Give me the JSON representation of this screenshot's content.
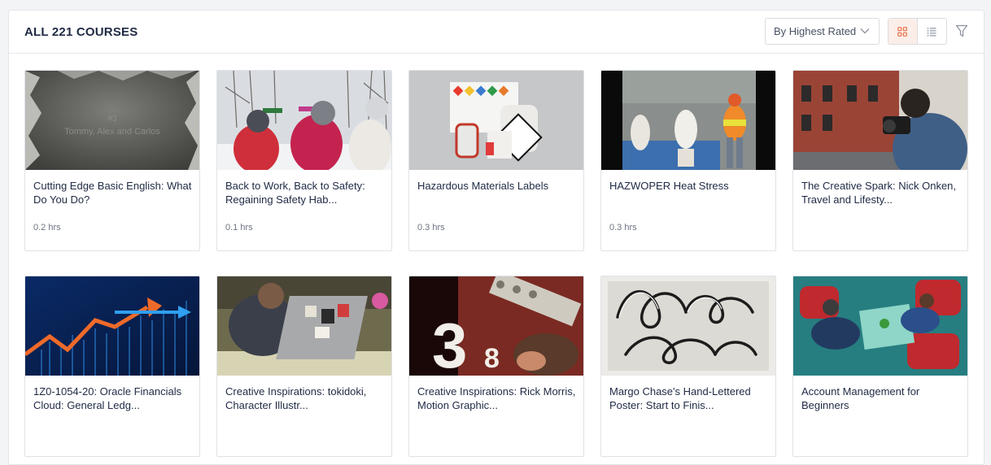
{
  "header": {
    "title": "ALL 221 COURSES",
    "sort_label": "By Highest Rated",
    "view_grid_icon": "grid-icon",
    "view_list_icon": "list-icon",
    "filter_icon": "filter-icon"
  },
  "colors": {
    "accent": "#e8704a",
    "title_text": "#1f2a44",
    "muted_text": "#6b7280"
  },
  "courses": [
    {
      "title": "Cutting Edge Basic English: What Do You Do?",
      "duration": "0.2 hrs",
      "thumb_text_1": "#3",
      "thumb_text_2": "Tommy, Alex and Carlos"
    },
    {
      "title": "Back to Work, Back to Safety: Regaining Safety Hab...",
      "duration": "0.1 hrs"
    },
    {
      "title": "Hazardous Materials Labels",
      "duration": "0.3 hrs"
    },
    {
      "title": "HAZWOPER Heat Stress",
      "duration": "0.3 hrs"
    },
    {
      "title": "The Creative Spark: Nick Onken, Travel and Lifesty...",
      "duration": ""
    },
    {
      "title": "1Z0-1054-20: Oracle Financials Cloud: General Ledg...",
      "duration": ""
    },
    {
      "title": "Creative Inspirations: tokidoki, Character Illustr...",
      "duration": ""
    },
    {
      "title": "Creative Inspirations: Rick Morris, Motion Graphic...",
      "duration": ""
    },
    {
      "title": "Margo Chase's Hand-Lettered Poster: Start to Finis...",
      "duration": ""
    },
    {
      "title": "Account Management for Beginners",
      "duration": ""
    }
  ]
}
